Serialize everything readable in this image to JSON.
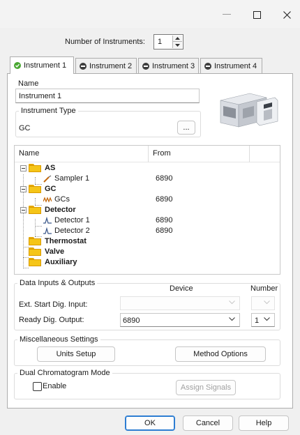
{
  "window": {
    "minimize_icon": "minimize-icon",
    "maximize_icon": "maximize-icon",
    "close_icon": "close-icon"
  },
  "instrument_count": {
    "label": "Number of Instruments:",
    "value": "1"
  },
  "tabs": [
    {
      "label": "Instrument 1",
      "status": "active",
      "icon": "green-check-circle"
    },
    {
      "label": "Instrument 2",
      "status": "inactive",
      "icon": "dark-minus-circle"
    },
    {
      "label": "Instrument 3",
      "status": "inactive",
      "icon": "dark-minus-circle"
    },
    {
      "label": "Instrument 4",
      "status": "inactive",
      "icon": "dark-minus-circle"
    }
  ],
  "name_section": {
    "label": "Name",
    "value": "Instrument 1"
  },
  "instrument_type": {
    "group_title": "Instrument Type",
    "value": "GC",
    "browse_label": "..."
  },
  "tree": {
    "columns": [
      "Name",
      "From"
    ],
    "rows": [
      {
        "name": "AS",
        "from": "",
        "bold": true,
        "kind": "folder"
      },
      {
        "name": "Sampler 1",
        "from": "6890",
        "bold": false,
        "kind": "sampler"
      },
      {
        "name": "GC",
        "from": "",
        "bold": true,
        "kind": "folder"
      },
      {
        "name": "GCs",
        "from": "6890",
        "bold": false,
        "kind": "gc"
      },
      {
        "name": "Detector",
        "from": "",
        "bold": true,
        "kind": "folder"
      },
      {
        "name": "Detector 1",
        "from": "6890",
        "bold": false,
        "kind": "detector"
      },
      {
        "name": "Detector 2",
        "from": "6890",
        "bold": false,
        "kind": "detector"
      },
      {
        "name": "Thermostat",
        "from": "",
        "bold": true,
        "kind": "folder"
      },
      {
        "name": "Valve",
        "from": "",
        "bold": true,
        "kind": "folder"
      },
      {
        "name": "Auxiliary",
        "from": "",
        "bold": true,
        "kind": "folder"
      }
    ]
  },
  "data_io": {
    "group_title": "Data Inputs & Outputs",
    "device_header": "Device",
    "number_header": "Number",
    "rows": [
      {
        "label": "Ext. Start Dig. Input:",
        "device": "",
        "number": "",
        "enabled": false
      },
      {
        "label": "Ready Dig. Output:",
        "device": "6890",
        "number": "1",
        "enabled": true
      }
    ]
  },
  "misc": {
    "group_title": "Miscellaneous Settings",
    "units_setup_label": "Units Setup",
    "method_options_label": "Method Options"
  },
  "dual": {
    "group_title": "Dual Chromatogram Mode",
    "enable_label": "Enable",
    "enable_checked": false,
    "assign_signals_label": "Assign Signals"
  },
  "footer": {
    "ok_label": "OK",
    "cancel_label": "Cancel",
    "help_label": "Help"
  },
  "colors": {
    "accent": "#2d7dd2",
    "folder": "#f5c518",
    "tab_active_icon": "#4aa832"
  }
}
